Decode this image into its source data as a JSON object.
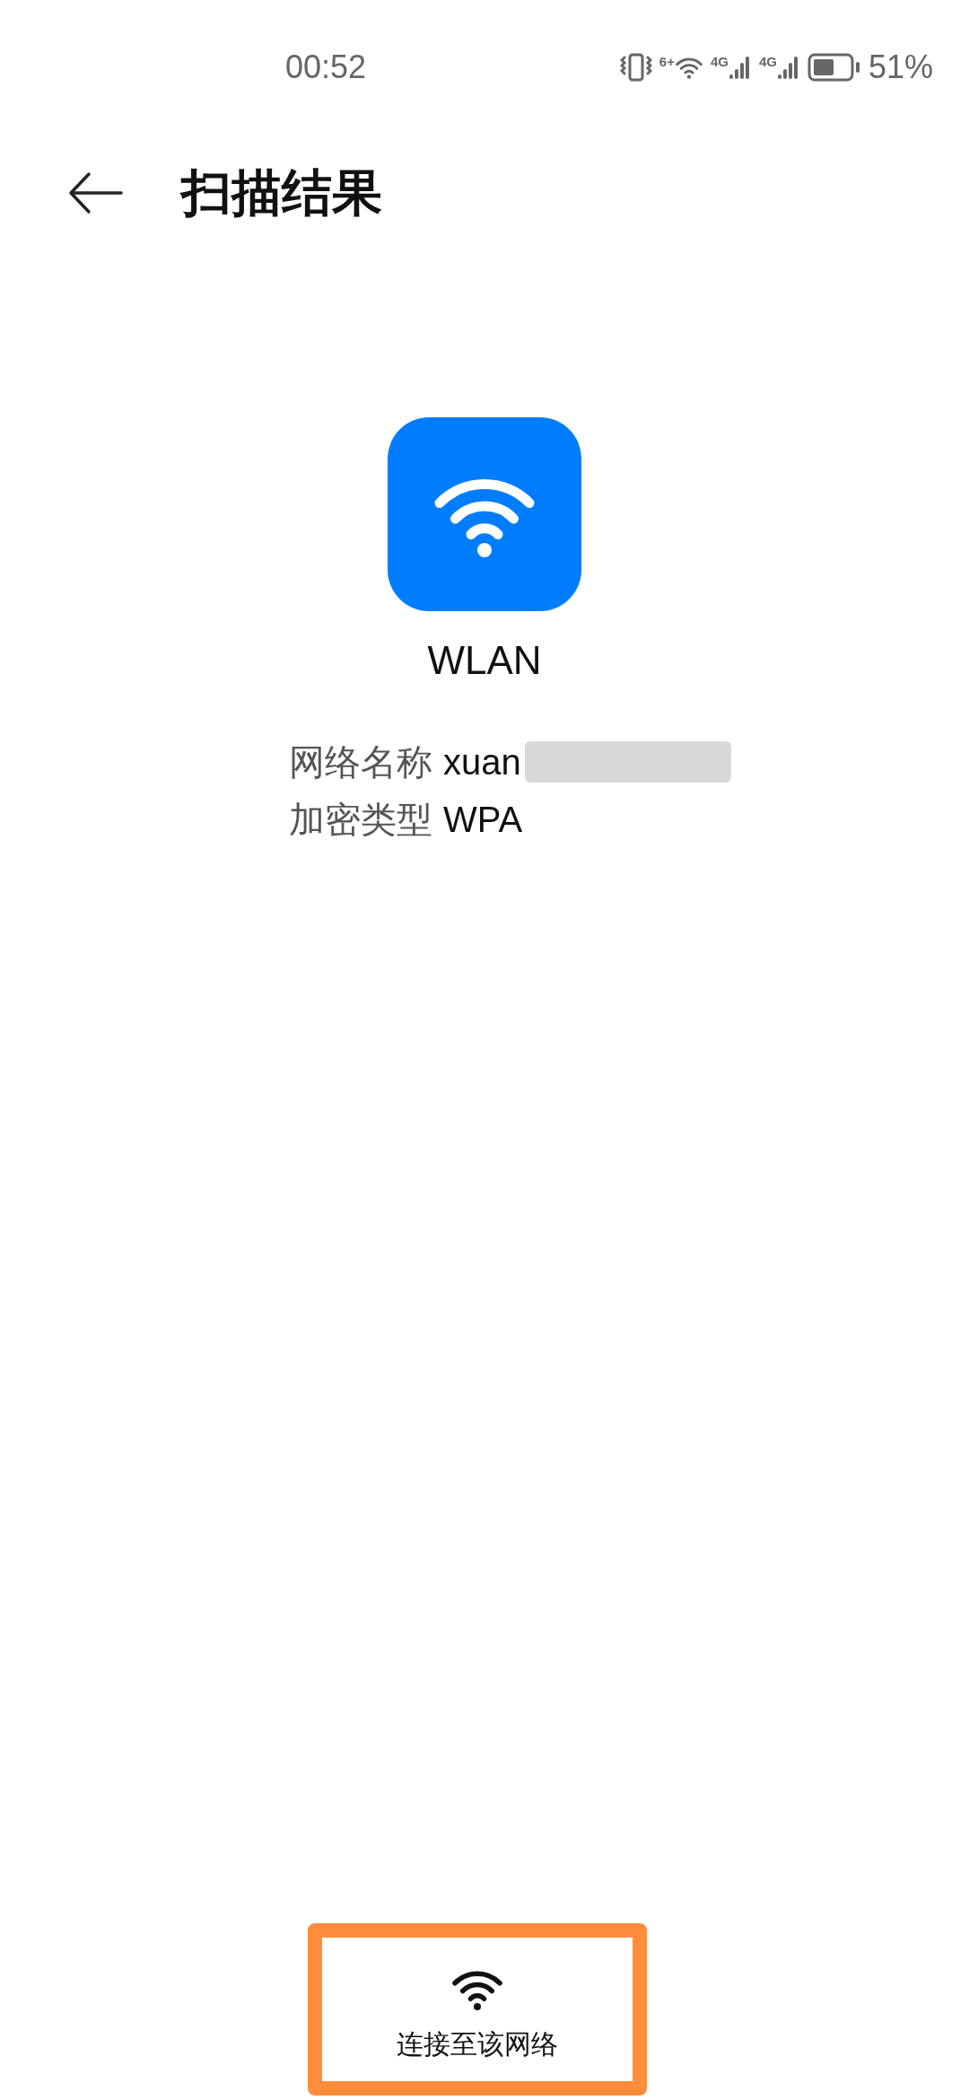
{
  "status_bar": {
    "time": "00:52",
    "battery": "51%",
    "signal_labels": [
      "6+",
      "4G",
      "4G"
    ]
  },
  "header": {
    "title": "扫描结果"
  },
  "network": {
    "type_label": "WLAN",
    "name_label": "网络名称",
    "name_value": "xuan",
    "encryption_label": "加密类型",
    "encryption_value": "WPA"
  },
  "connect_button": {
    "label": "连接至该网络"
  }
}
